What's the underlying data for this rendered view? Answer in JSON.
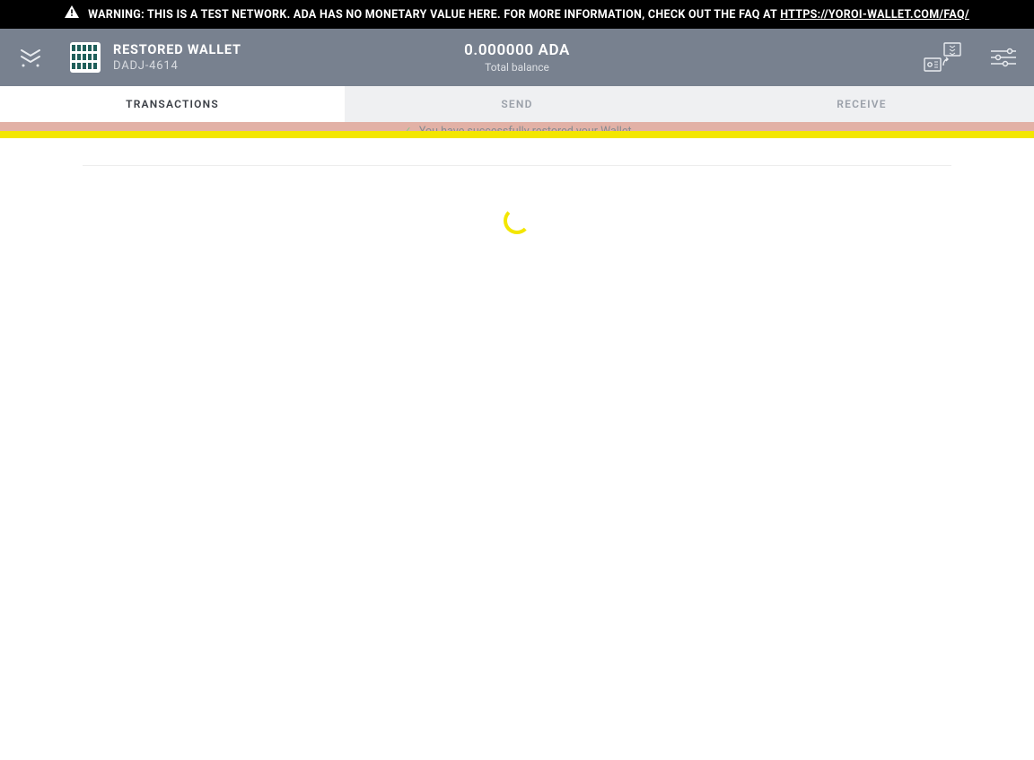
{
  "warning": {
    "text_prefix": "WARNING: THIS IS A TEST NETWORK. ADA HAS NO MONETARY VALUE HERE. FOR MORE INFORMATION, CHECK OUT THE FAQ AT ",
    "link_text": "HTTPS://YOROI-WALLET.COM/FAQ/"
  },
  "wallet": {
    "name": "RESTORED WALLET",
    "code": "DADJ-4614"
  },
  "balance": {
    "amount": "0.000000 ADA",
    "label": "Total balance"
  },
  "tabs": {
    "transactions": "TRANSACTIONS",
    "send": "SEND",
    "receive": "RECEIVE"
  },
  "notification": {
    "message": "You have successfully restored your Wallet"
  }
}
